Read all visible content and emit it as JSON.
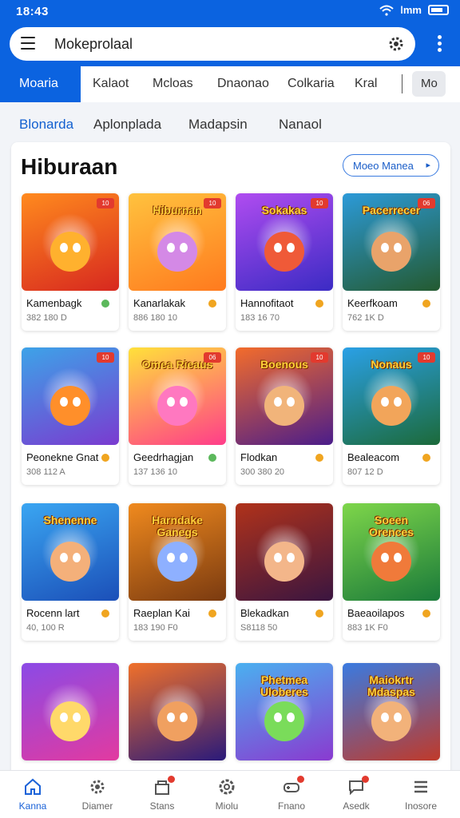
{
  "status": {
    "time": "18:43",
    "network": "ǀmm"
  },
  "search": {
    "text": "Mokeprolaal",
    "menu_icon": "hamburger-icon",
    "right_icon": "gear-icon"
  },
  "tabs": [
    "Moaria",
    "Kalaot",
    "Mcloas",
    "Dnaonao",
    "Colkaria",
    "Kral",
    "Mo"
  ],
  "subtabs": [
    "Blonarda",
    "Aplonplada",
    "Madapsin",
    "Nanaol"
  ],
  "section": {
    "title": "Hiburaan",
    "more": "Moeo Manea",
    "more_arrow": "▸"
  },
  "games": [
    {
      "name": "Kamenbagk",
      "sub": "382 180 D",
      "banner": "",
      "badge": "10",
      "dot": "#5cb85c",
      "c1": "#ff8a1e",
      "c2": "#d7281f",
      "char": "#ffb12e"
    },
    {
      "name": "Kanarlakak",
      "sub": "886 180 10",
      "banner": "Hiburnan",
      "badge": "10",
      "dot": "#f0a520",
      "c1": "#ffc23e",
      "c2": "#ff7a1e",
      "char": "#d489e6"
    },
    {
      "name": "Hannofitaot",
      "sub": "183 16 70",
      "banner": "Sokakas",
      "badge": "10",
      "dot": "#f0a520",
      "c1": "#b04cf0",
      "c2": "#3b2bc4",
      "char": "#ef5a38"
    },
    {
      "name": "Keerfkoam",
      "sub": "762 1K D",
      "banner": "Pacerrecer",
      "badge": "06",
      "dot": "#f0a520",
      "c1": "#2c9ad8",
      "c2": "#245a30",
      "char": "#e9a36a"
    },
    {
      "name": "Peonekne Gnat",
      "sub": "308 112 A",
      "banner": "",
      "badge": "10",
      "dot": "#f0a520",
      "c1": "#3da3e8",
      "c2": "#7a3bd0",
      "char": "#ff8f2a"
    },
    {
      "name": "Geedrhagjan",
      "sub": "137 136 10",
      "banner": "Omea Rieaus",
      "badge": "06",
      "dot": "#5cb85c",
      "c1": "#ffe13a",
      "c2": "#ff3d8a",
      "char": "#ff78c0"
    },
    {
      "name": "Flodkan",
      "sub": "300 380 20",
      "banner": "Boenous",
      "badge": "10",
      "dot": "#f0a520",
      "c1": "#f36c2b",
      "c2": "#4b1d8a",
      "char": "#f1b47a"
    },
    {
      "name": "Bealeacom",
      "sub": "807 12 D",
      "banner": "Nonaus",
      "badge": "10",
      "dot": "#f0a520",
      "c1": "#2aa0e6",
      "c2": "#1c6a3a",
      "char": "#f2a55a"
    },
    {
      "name": "Rocenn lart",
      "sub": "40, 100 R",
      "banner": "Shenenne",
      "badge": "",
      "dot": "#f0a520",
      "c1": "#3aa6f2",
      "c2": "#1b4fb8",
      "char": "#f4b07a"
    },
    {
      "name": "Raeplan Kai",
      "sub": "183 190 F0",
      "banner": "Harndake Ganegs",
      "badge": "",
      "dot": "#f0a520",
      "c1": "#f08a1e",
      "c2": "#7a3a10",
      "char": "#8eb0ff"
    },
    {
      "name": "Blekadkan",
      "sub": "S8118 50",
      "banner": "",
      "badge": "",
      "dot": "#f0a520",
      "c1": "#b0321a",
      "c2": "#3a1540",
      "char": "#f3b68a"
    },
    {
      "name": "Baeaoilapos",
      "sub": "883 1K F0",
      "banner": "Soeen Orences",
      "badge": "",
      "dot": "#f0a520",
      "c1": "#7ed64a",
      "c2": "#1a7a3a",
      "char": "#f07a3a"
    },
    {
      "name": "",
      "sub": "",
      "banner": "",
      "badge": "",
      "dot": "",
      "c1": "#8b4ae6",
      "c2": "#e23aa0",
      "char": "#ffd96a"
    },
    {
      "name": "",
      "sub": "",
      "banner": "",
      "badge": "",
      "dot": "",
      "c1": "#f0702a",
      "c2": "#2a1a7a",
      "char": "#f0a060"
    },
    {
      "name": "",
      "sub": "",
      "banner": "Phetmea Uloberes",
      "badge": "",
      "dot": "",
      "c1": "#4ab0f0",
      "c2": "#8a3ad0",
      "char": "#7adc5a"
    },
    {
      "name": "",
      "sub": "",
      "banner": "Maiokrtr Mdaspas",
      "badge": "",
      "dot": "",
      "c1": "#3a7ae0",
      "c2": "#c03a2a",
      "char": "#f2b27a"
    }
  ],
  "nav": [
    {
      "label": "Kanna",
      "icon": "home-icon",
      "active": true,
      "badge": false
    },
    {
      "label": "Diamer",
      "icon": "gear-icon",
      "active": false,
      "badge": false
    },
    {
      "label": "Stans",
      "icon": "store-icon",
      "active": false,
      "badge": true
    },
    {
      "label": "Miolu",
      "icon": "settings-icon",
      "active": false,
      "badge": false
    },
    {
      "label": "Fnano",
      "icon": "game-icon",
      "active": false,
      "badge": true
    },
    {
      "label": "Asedk",
      "icon": "chat-icon",
      "active": false,
      "badge": true
    },
    {
      "label": "Inosore",
      "icon": "list-icon",
      "active": false,
      "badge": false
    }
  ]
}
